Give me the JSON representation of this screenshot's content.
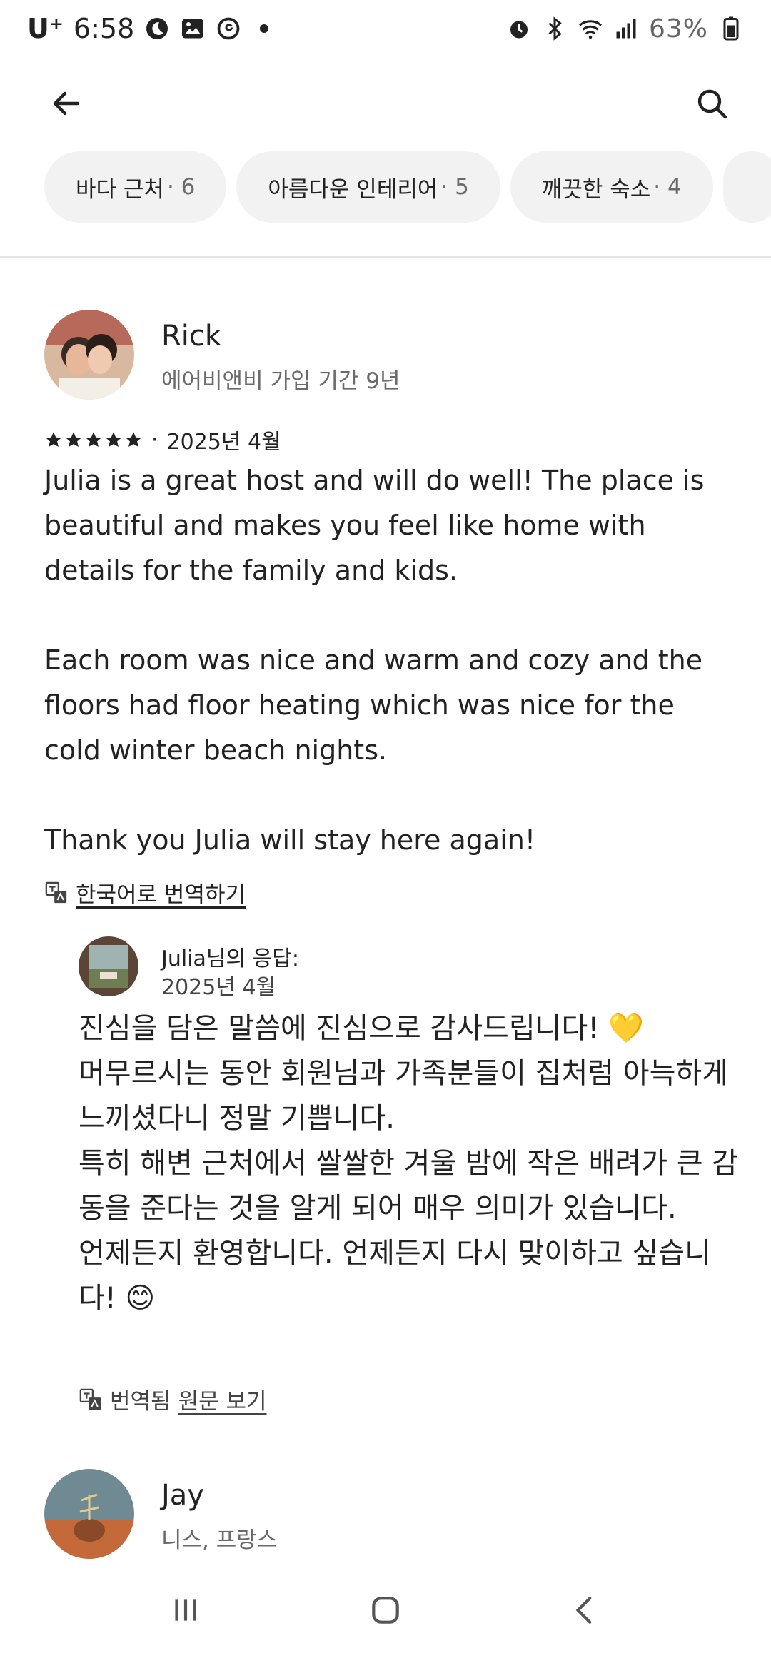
{
  "status_bar": {
    "carrier": "U⁺",
    "time": "6:58",
    "battery": "63%"
  },
  "filters": [
    {
      "label": "바다 근처",
      "count": "· 6"
    },
    {
      "label": "아름다운 인테리어",
      "count": "· 5"
    },
    {
      "label": "깨끗한 숙소",
      "count": "· 4"
    }
  ],
  "review1": {
    "name": "Rick",
    "member_since": "에어비앤비 가입 기간 9년",
    "rating": 5,
    "date": "2025년 4월",
    "text": "Julia is a great host and will do well! The place is beautiful and makes you feel like home with details for the family and kids.\n\nEach room was nice and warm and cozy and the floors had floor heating which was nice for the cold winter beach nights.\n\nThank you Julia will stay here again!",
    "translate_label": "한국어로 번역하기"
  },
  "response": {
    "title": "Julia님의 응답:",
    "date": "2025년 4월",
    "text": "진심을 담은 말씀에 진심으로 감사드립니다! 💛\n머무르시는 동안 회원님과 가족분들이 집처럼 아늑하게 느끼셨다니 정말 기쁩니다.\n특히 해변 근처에서 쌀쌀한 겨울 밤에 작은 배려가 큰 감동을 준다는 것을 알게 되어 매우 의미가 있습니다.\n언제든지 환영합니다. 언제든지 다시 맞이하고 싶습니다! 😊",
    "translated_label": "번역됨",
    "original_label": "원문 보기"
  },
  "review2": {
    "name": "Jay",
    "location": "니스, 프랑스"
  },
  "icons": {
    "back": "arrow-left-icon",
    "search": "search-icon",
    "translate": "translate-icon",
    "nav_recent": "recent-apps-icon",
    "nav_home": "home-icon",
    "nav_back": "back-icon"
  }
}
